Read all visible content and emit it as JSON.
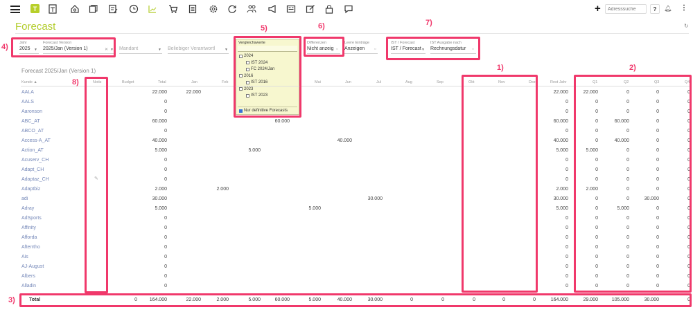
{
  "toolbar": {
    "logo": "T",
    "search_placeholder": "Adresssuche",
    "help": "?",
    "add": "+",
    "more": "⋮"
  },
  "page": {
    "title": "Forecast"
  },
  "filters": {
    "jahr": {
      "label": "Jahr",
      "value": "2025"
    },
    "version": {
      "label": "Forecast Version",
      "value": "2025/Jan (Version 1)"
    },
    "mandant": {
      "placeholder": "Mandant"
    },
    "verantwortl": {
      "placeholder": "Beliebiger Verantwortl"
    },
    "vergleichswerte": {
      "label": "Vergleichswerte",
      "items": [
        {
          "label": "2024",
          "indent": false,
          "checked": false
        },
        {
          "label": "IST 2024",
          "indent": true,
          "checked": false
        },
        {
          "label": "FC 2024/Jan",
          "indent": true,
          "checked": false
        },
        {
          "label": "2016",
          "indent": false,
          "checked": false
        },
        {
          "label": "IST 2016",
          "indent": true,
          "checked": false
        },
        {
          "label": "2023",
          "indent": false,
          "checked": false
        },
        {
          "label": "IST 2023",
          "indent": true,
          "checked": false
        }
      ],
      "only_definitive": "Nur definitive Forecasts"
    },
    "differenzen": {
      "label": "Differenzen",
      "value": "Nicht anzeig"
    },
    "leere": {
      "label": "Leere Einträge",
      "value": "Anzeigen"
    },
    "ist_forecast": {
      "label": "IST / Forecast",
      "value": "IST / Forecast"
    },
    "ist_ausgabe": {
      "label": "IST Ausgabe nach",
      "value": "Rechnungsdatur"
    }
  },
  "table": {
    "title": "Forecast 2025/Jan (Version 1)",
    "headers": {
      "kunde": "Kunde ▲",
      "notiz": "Notiz",
      "budget": "Budget",
      "total": "Total",
      "jan": "Jan",
      "feb": "Feb",
      "mai": "Mai",
      "jun": "Jun",
      "jul": "Jul",
      "aug": "Aug",
      "sep": "Sep",
      "okt": "Okt",
      "nov": "Nov",
      "dez": "Dez",
      "rest_jahr": "Rest Jahr",
      "q1": "Q1",
      "q2": "Q2",
      "q3": "Q3",
      "q4": "Q4"
    },
    "rows": [
      {
        "name": "AALA",
        "total": "22.000",
        "jan": "22.000",
        "rest": "22.000",
        "q1": "22.000",
        "q2": "0",
        "q3": "0",
        "q4": "0"
      },
      {
        "name": "AALS",
        "total": "0",
        "rest": "0",
        "q1": "0",
        "q2": "0",
        "q3": "0",
        "q4": "0"
      },
      {
        "name": "Aaronson",
        "total": "0",
        "rest": "0",
        "q1": "0",
        "q2": "0",
        "q3": "0",
        "q4": "0"
      },
      {
        "name": "ABC_AT",
        "total": "60.000",
        "mai": "60.000",
        "rest": "60.000",
        "q1": "0",
        "q2": "60.000",
        "q3": "0",
        "q4": "0"
      },
      {
        "name": "ABCO_AT",
        "total": "0",
        "rest": "0",
        "q1": "0",
        "q2": "0",
        "q3": "0",
        "q4": "0"
      },
      {
        "name": "Access-A_AT",
        "total": "40.000",
        "jun": "40.000",
        "rest": "40.000",
        "q1": "0",
        "q2": "40.000",
        "q3": "0",
        "q4": "0"
      },
      {
        "name": "Action_AT",
        "total": "5.000",
        "mar": "5.000",
        "rest": "5.000",
        "q1": "5.000",
        "q2": "0",
        "q3": "0",
        "q4": "0"
      },
      {
        "name": "Acuserv_CH",
        "total": "0",
        "rest": "0",
        "q1": "0",
        "q2": "0",
        "q3": "0",
        "q4": "0"
      },
      {
        "name": "Adapt_CH",
        "total": "0",
        "rest": "0",
        "q1": "0",
        "q2": "0",
        "q3": "0",
        "q4": "0"
      },
      {
        "name": "Adaptaz_CH",
        "total": "0",
        "rest": "0",
        "q1": "0",
        "q2": "0",
        "q3": "0",
        "q4": "0"
      },
      {
        "name": "Adaptbiz",
        "total": "2.000",
        "feb": "2.000",
        "rest": "2.000",
        "q1": "2.000",
        "q2": "0",
        "q3": "0",
        "q4": "0"
      },
      {
        "name": "adi",
        "total": "30.000",
        "jul": "30.000",
        "rest": "30.000",
        "q1": "0",
        "q2": "0",
        "q3": "30.000",
        "q4": "0"
      },
      {
        "name": "Adray",
        "total": "5.000",
        "mai": "5.000",
        "rest": "5.000",
        "q1": "0",
        "q2": "5.000",
        "q3": "0",
        "q4": "0"
      },
      {
        "name": "AdSports",
        "total": "0",
        "rest": "0",
        "q1": "0",
        "q2": "0",
        "q3": "0",
        "q4": "0"
      },
      {
        "name": "Affinity",
        "total": "0",
        "rest": "0",
        "q1": "0",
        "q2": "0",
        "q3": "0",
        "q4": "0"
      },
      {
        "name": "Afforda",
        "total": "0",
        "rest": "0",
        "q1": "0",
        "q2": "0",
        "q3": "0",
        "q4": "0"
      },
      {
        "name": "Afterrtho",
        "total": "0",
        "rest": "0",
        "q1": "0",
        "q2": "0",
        "q3": "0",
        "q4": "0"
      },
      {
        "name": "Ais",
        "total": "0",
        "rest": "0",
        "q1": "0",
        "q2": "0",
        "q3": "0",
        "q4": "0"
      },
      {
        "name": "AJ-August",
        "total": "0",
        "rest": "0",
        "q1": "0",
        "q2": "0",
        "q3": "0",
        "q4": "0"
      },
      {
        "name": "Albers",
        "total": "0",
        "rest": "0",
        "q1": "0",
        "q2": "0",
        "q3": "0",
        "q4": "0"
      },
      {
        "name": "Alladin",
        "total": "0",
        "rest": "0",
        "q1": "0",
        "q2": "0",
        "q3": "0",
        "q4": "0"
      }
    ],
    "total_row": {
      "label": "Total",
      "budget": "0",
      "total": "164.000",
      "jan": "22.000",
      "feb": "2.000",
      "mar": "5.000",
      "apr": "60.000",
      "mai": "5.000",
      "jun": "40.000",
      "jul": "30.000",
      "aug": "0",
      "sep": "0",
      "okt": "0",
      "nov": "0",
      "dez": "0",
      "rest": "164.000",
      "q1": "29.000",
      "q2": "105.000",
      "q3": "30.000",
      "q4": "0"
    }
  },
  "annotations": [
    "1)",
    "2)",
    "3)",
    "4)",
    "5)",
    "6)",
    "7)",
    "8)"
  ],
  "colors": {
    "accent": "#b2cc2a",
    "highlight": "#f0386b",
    "link": "#7487b8"
  }
}
